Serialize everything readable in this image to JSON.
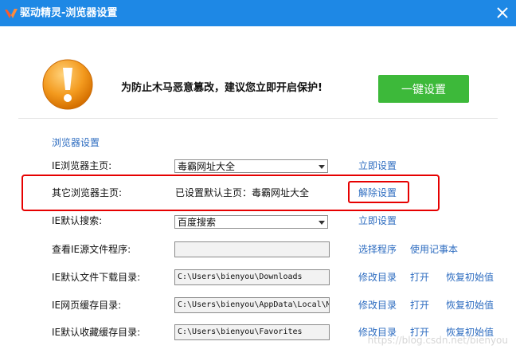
{
  "window": {
    "title": "驱动精灵-浏览器设置"
  },
  "header": {
    "warning": "为防止木马恶意篡改，建议您立即开启保护!",
    "one_key_button": "一键设置"
  },
  "section_title": "浏览器设置",
  "rows": {
    "ie_homepage": {
      "label": "IE浏览器主页:",
      "value": "毒霸网址大全",
      "action": "立即设置"
    },
    "other_homepage": {
      "label": "其它浏览器主页:",
      "status": "已设置默认主页：毒霸网址大全",
      "action": "解除设置"
    },
    "ie_search": {
      "label": "IE默认搜索:",
      "value": "百度搜索",
      "action": "立即设置"
    },
    "ie_source": {
      "label": "查看IE源文件程序:",
      "value": "",
      "action1": "选择程序",
      "action2": "使用记事本"
    },
    "ie_download": {
      "label": "IE默认文件下载目录:",
      "value": "C:\\Users\\bienyou\\Downloads",
      "action1": "修改目录",
      "action2": "打开",
      "action3": "恢复初始值"
    },
    "ie_cache": {
      "label": "IE网页缓存目录:",
      "value": "C:\\Users\\bienyou\\AppData\\Local\\M",
      "action1": "修改目录",
      "action2": "打开",
      "action3": "恢复初始值"
    },
    "ie_favorites": {
      "label": "IE默认收藏缓存目录:",
      "value": "C:\\Users\\bienyou\\Favorites",
      "action1": "修改目录",
      "action2": "打开",
      "action3": "恢复初始值"
    }
  },
  "watermark": "https://blog.csdn.net/bienyou",
  "colors": {
    "titlebar": "#1e88e5",
    "button": "#3db93a",
    "link": "#2d6cc0",
    "highlight": "#e60000",
    "warning_icon": "#f39a1e"
  }
}
